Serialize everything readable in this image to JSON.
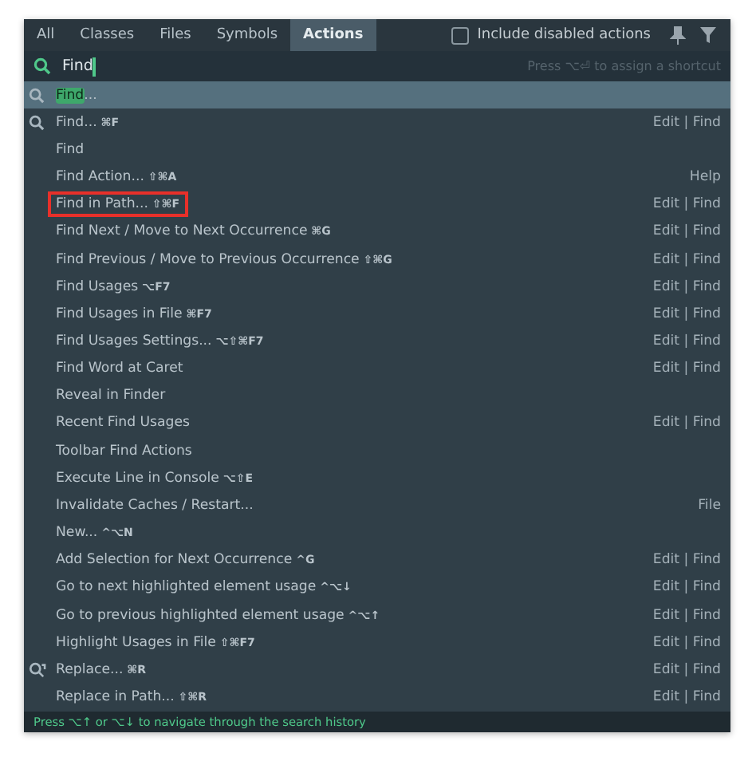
{
  "tabs": [
    {
      "label": "All",
      "selected": false
    },
    {
      "label": "Classes",
      "selected": false
    },
    {
      "label": "Files",
      "selected": false
    },
    {
      "label": "Symbols",
      "selected": false
    },
    {
      "label": "Actions",
      "selected": true
    }
  ],
  "include_disabled": {
    "label": "Include disabled actions",
    "checked": false
  },
  "search": {
    "value": "Find",
    "hint": "Press ⌥⏎ to assign a shortcut"
  },
  "rows": [
    {
      "match": "Find",
      "text": "...",
      "kind": "search",
      "selected": true,
      "outlined": false
    },
    {
      "text": "Find...",
      "shortcut": "⌘F",
      "group": "Edit | Find",
      "kind": "search",
      "selected": false,
      "outlined": false
    },
    {
      "text": "Find",
      "selected": false,
      "outlined": false
    },
    {
      "text": "Find Action...",
      "shortcut": "⇧⌘A",
      "group": "Help",
      "selected": false,
      "outlined": false
    },
    {
      "text": "Find in Path...",
      "shortcut": "⇧⌘F",
      "group": "Edit | Find",
      "selected": false,
      "outlined": true
    },
    {
      "text": "Find Next / Move to Next Occurrence",
      "shortcut": "⌘G",
      "group": "Edit | Find",
      "selected": false,
      "outlined": false
    },
    {
      "text": "Find Previous / Move to Previous Occurrence",
      "shortcut": "⇧⌘G",
      "group": "Edit | Find",
      "selected": false,
      "outlined": false
    },
    {
      "text": "Find Usages",
      "shortcut": "⌥F7",
      "group": "Edit | Find",
      "selected": false,
      "outlined": false
    },
    {
      "text": "Find Usages in File",
      "shortcut": "⌘F7",
      "group": "Edit | Find",
      "selected": false,
      "outlined": false
    },
    {
      "text": "Find Usages Settings...",
      "shortcut": "⌥⇧⌘F7",
      "group": "Edit | Find",
      "selected": false,
      "outlined": false
    },
    {
      "text": "Find Word at Caret",
      "group": "Edit | Find",
      "selected": false,
      "outlined": false
    },
    {
      "text": "Reveal in Finder",
      "selected": false,
      "outlined": false
    },
    {
      "text": "Recent Find Usages",
      "group": "Edit | Find",
      "selected": false,
      "outlined": false
    },
    {
      "text": "Toolbar Find Actions",
      "selected": false,
      "outlined": false
    },
    {
      "text": "Execute Line in Console",
      "shortcut": "⌥⇧E",
      "selected": false,
      "outlined": false
    },
    {
      "text": "Invalidate Caches / Restart...",
      "group": "File",
      "selected": false,
      "outlined": false
    },
    {
      "text": "New...",
      "shortcut": "^⌥N",
      "selected": false,
      "outlined": false
    },
    {
      "text": "Add Selection for Next Occurrence",
      "shortcut": "^G",
      "group": "Edit | Find",
      "selected": false,
      "outlined": false
    },
    {
      "text": "Go to next highlighted element usage",
      "shortcut": "^⌥↓",
      "group": "Edit | Find",
      "selected": false,
      "outlined": false
    },
    {
      "text": "Go to previous highlighted element usage",
      "shortcut": "^⌥↑",
      "group": "Edit | Find",
      "selected": false,
      "outlined": false
    },
    {
      "text": "Highlight Usages in File",
      "shortcut": "⇧⌘F7",
      "group": "Edit | Find",
      "selected": false,
      "outlined": false
    },
    {
      "text": "Replace...",
      "shortcut": "⌘R",
      "group": "Edit | Find",
      "kind": "replace",
      "selected": false,
      "outlined": false
    },
    {
      "text": "Replace in Path...",
      "shortcut": "⇧⌘R",
      "group": "Edit | Find",
      "selected": false,
      "outlined": false
    }
  ],
  "status": "Press ⌥↑ or ⌥↓ to navigate through the search history"
}
